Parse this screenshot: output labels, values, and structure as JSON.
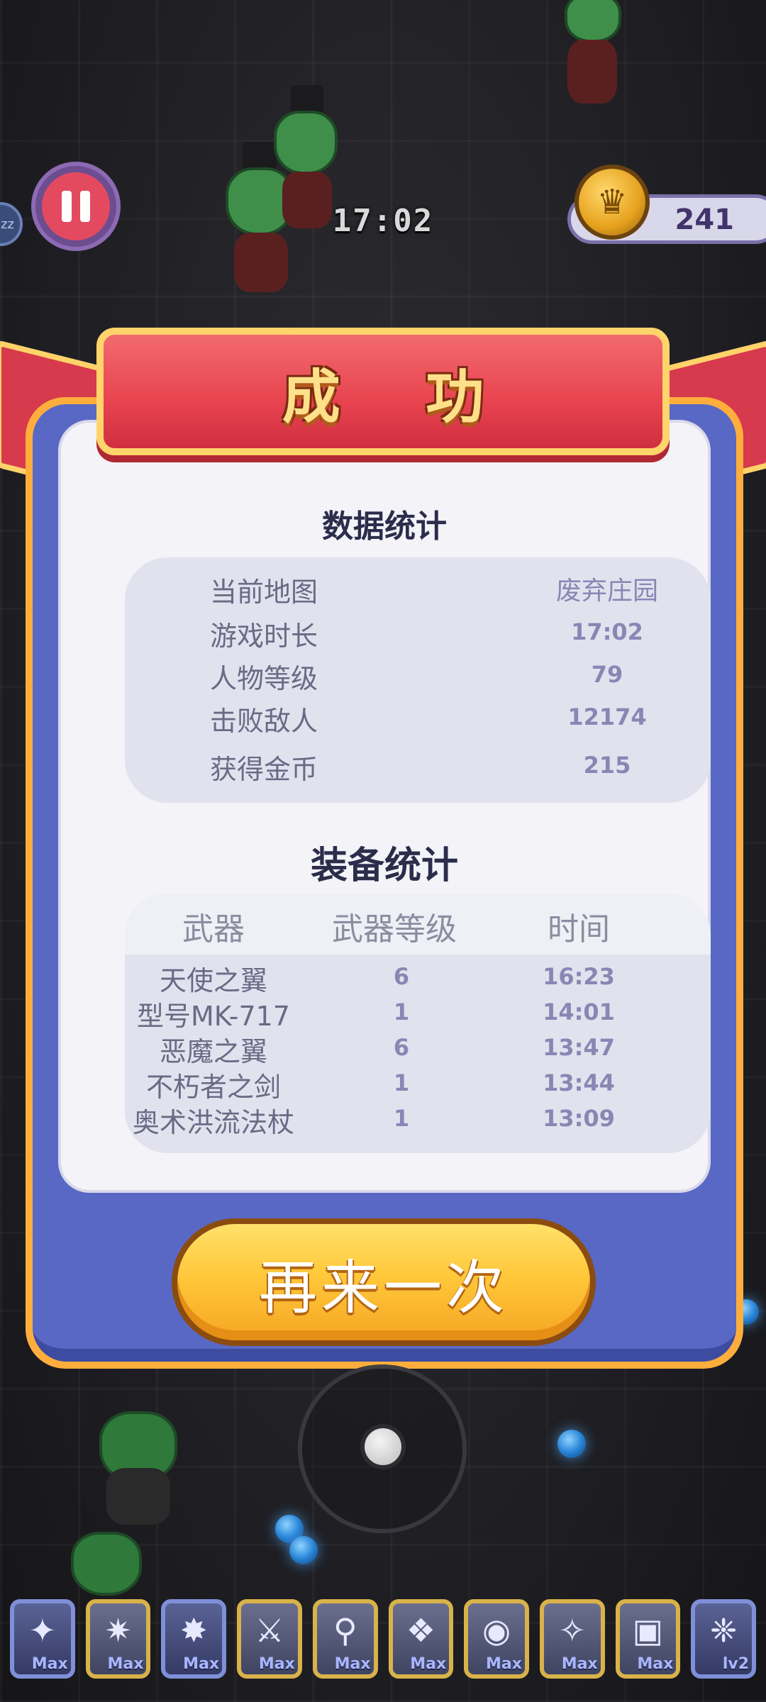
{
  "hud": {
    "timer": "17:02",
    "coins": "241",
    "zz_label": "zz"
  },
  "result": {
    "title": "成 功",
    "data_section_title": "数据统计",
    "stats": [
      {
        "label": "当前地图",
        "value": "废弃庄园"
      },
      {
        "label": "游戏时长",
        "value": "17:02"
      },
      {
        "label": "人物等级",
        "value": "79"
      },
      {
        "label": "击败敌人",
        "value": "12174"
      },
      {
        "label": "获得金币",
        "value": "215"
      }
    ],
    "equip_section_title": "装备统计",
    "equip_headers": {
      "weapon": "武器",
      "level": "武器等级",
      "time": "时间"
    },
    "equipment": [
      {
        "name": "天使之翼",
        "level": "6",
        "time": "16:23"
      },
      {
        "name": "型号MK-717",
        "level": "1",
        "time": "14:01"
      },
      {
        "name": "恶魔之翼",
        "level": "6",
        "time": "13:47"
      },
      {
        "name": "不朽者之剑",
        "level": "1",
        "time": "13:44"
      },
      {
        "name": "奥术洪流法杖",
        "level": "1",
        "time": "13:09"
      }
    ],
    "again_button": "再来一次"
  },
  "skill_bar": [
    {
      "icon": "wings-icon",
      "glyph": "✦",
      "level": "Max"
    },
    {
      "icon": "gun-icon",
      "glyph": "✷",
      "level": "Max"
    },
    {
      "icon": "demon-wings-icon",
      "glyph": "✸",
      "level": "Max"
    },
    {
      "icon": "sword-icon",
      "glyph": "⚔",
      "level": "Max"
    },
    {
      "icon": "staff-icon",
      "glyph": "⚲",
      "level": "Max"
    },
    {
      "icon": "scroll-icon",
      "glyph": "❖",
      "level": "Max"
    },
    {
      "icon": "shield-icon",
      "glyph": "◉",
      "level": "Max"
    },
    {
      "icon": "torch-icon",
      "glyph": "✧",
      "level": "Max"
    },
    {
      "icon": "book-icon",
      "glyph": "▣",
      "level": "Max"
    },
    {
      "icon": "crystal-icon",
      "glyph": "❈",
      "level": "lv2"
    }
  ],
  "colors": {
    "panel_border": "#ffae3d",
    "panel_fill": "#5868c4",
    "ribbon": "#e8434f",
    "button": "#ffc83a"
  }
}
